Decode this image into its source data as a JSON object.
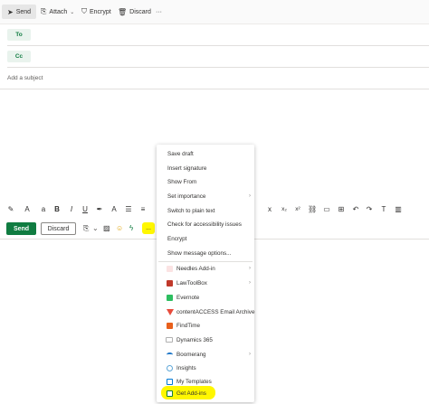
{
  "command_bar": {
    "send_label": "Send",
    "attach_label": "Attach",
    "encrypt_label": "Encrypt",
    "discard_label": "Discard",
    "more_label": "···"
  },
  "recipients": {
    "to_label": "To",
    "cc_label": "Cc"
  },
  "subject": {
    "placeholder": "Add a subject"
  },
  "format_toolbar": {
    "bold": "B",
    "italic": "I",
    "underline": "U",
    "subscript": "x₂",
    "superscript": "x²"
  },
  "action_bar": {
    "send_label": "Send",
    "discard_label": "Discard",
    "more_label": "..."
  },
  "menu": {
    "items": [
      {
        "label": "Save draft"
      },
      {
        "label": "Insert signature"
      },
      {
        "label": "Show From"
      },
      {
        "label": "Set importance",
        "submenu": true
      },
      {
        "label": "Switch to plain text"
      },
      {
        "label": "Check for accessibility issues"
      },
      {
        "label": "Encrypt"
      },
      {
        "label": "Show message options..."
      }
    ],
    "addins": [
      {
        "label": "Needles Add-in",
        "icon": "needles-icon",
        "color": "#d9534f",
        "submenu": true
      },
      {
        "label": "LawToolBox",
        "icon": "lawtoolbox-icon",
        "color": "#c0392b",
        "submenu": true
      },
      {
        "label": "Evernote",
        "icon": "evernote-icon",
        "color": "#2dbe60"
      },
      {
        "label": "contentACCESS Email Archive",
        "icon": "contentaccess-icon",
        "color": "#e74c3c"
      },
      {
        "label": "FindTime",
        "icon": "findtime-icon",
        "color": "#e8601c"
      },
      {
        "label": "Dynamics 365",
        "icon": "dynamics-icon",
        "color": "#3b6ea5"
      },
      {
        "label": "Boomerang",
        "icon": "boomerang-icon",
        "color": "#1f78c8",
        "submenu": true
      },
      {
        "label": "Insights",
        "icon": "insights-icon",
        "color": "#5ea7d8"
      },
      {
        "label": "My Templates",
        "icon": "templates-icon",
        "color": "#0078d4"
      },
      {
        "label": "Get Add-ins",
        "icon": "get-addins-icon",
        "color": "#107c41"
      }
    ]
  },
  "colors": {
    "accent": "#107c41",
    "highlight": "#fff700"
  }
}
